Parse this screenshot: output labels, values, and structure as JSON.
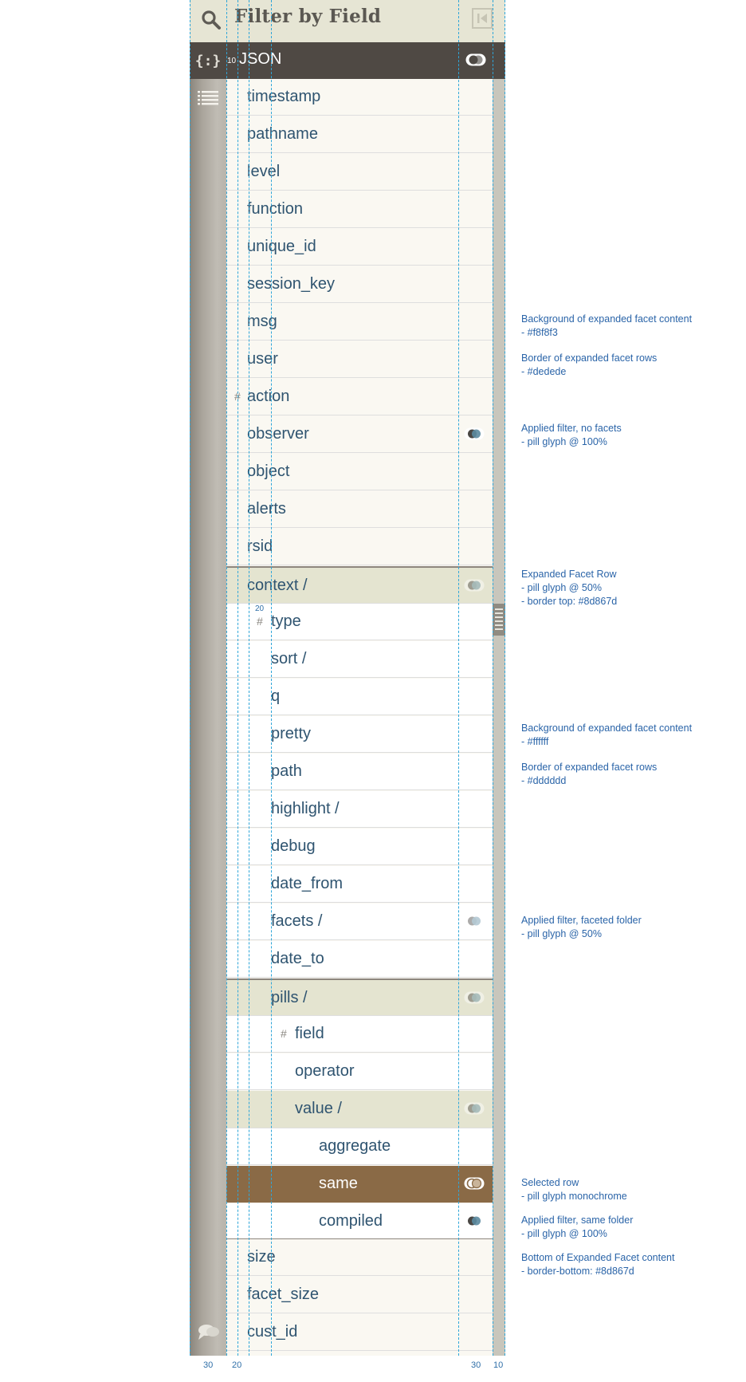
{
  "header": {
    "title": "Filter by Field"
  },
  "json_bar": {
    "icon": "{:}",
    "label": "JSON",
    "indent_mark": "10"
  },
  "rows": [
    {
      "label": "timestamp"
    },
    {
      "label": "pathname"
    },
    {
      "label": "level"
    },
    {
      "label": "function"
    },
    {
      "label": "unique_id"
    },
    {
      "label": "session_key"
    },
    {
      "label": "msg"
    },
    {
      "label": "user"
    },
    {
      "label": "action",
      "hash": "#"
    },
    {
      "label": "observer",
      "pill": "full"
    },
    {
      "label": "object"
    },
    {
      "label": "alerts"
    },
    {
      "label": "rsid"
    },
    {
      "label": "context /",
      "pill": "half"
    },
    {
      "label": "type",
      "hash": "#",
      "indent_mark": "20"
    },
    {
      "label": "sort /"
    },
    {
      "label": "q"
    },
    {
      "label": "pretty"
    },
    {
      "label": "path"
    },
    {
      "label": "highlight /"
    },
    {
      "label": "debug"
    },
    {
      "label": "date_from"
    },
    {
      "label": "facets /",
      "pill": "half"
    },
    {
      "label": "date_to"
    },
    {
      "label": "pills /",
      "pill": "half"
    },
    {
      "label": "field",
      "hash": "#"
    },
    {
      "label": "operator"
    },
    {
      "label": "value /",
      "pill": "half"
    },
    {
      "label": "aggregate"
    },
    {
      "label": "same",
      "pill": "mono"
    },
    {
      "label": "compiled",
      "pill": "full"
    },
    {
      "label": "size"
    },
    {
      "label": "facet_size"
    },
    {
      "label": "cust_id"
    }
  ],
  "measurements": {
    "rail": "30",
    "indent": "20",
    "pill_column": "30",
    "scrollbar": "10"
  },
  "annotations": [
    {
      "title": "Background of expanded facet content",
      "detail": "- #f8f8f3"
    },
    {
      "title": "Border of expanded facet rows",
      "detail": "- #dedede"
    },
    {
      "title": "Applied filter,  no facets",
      "detail": "- pill glyph @ 100%"
    },
    {
      "title": "Expanded Facet Row",
      "detail": "- pill glyph @ 50%",
      "detail2": "- border top: #8d867d"
    },
    {
      "title": "Background of expanded facet content",
      "detail": "- #ffffff"
    },
    {
      "title": "Border of expanded facet rows",
      "detail": "- #dddddd"
    },
    {
      "title": "Applied filter, faceted folder",
      "detail": "- pill glyph @ 50%"
    },
    {
      "title": "Selected row",
      "detail": "- pill glyph monochrome"
    },
    {
      "title": "Applied filter, same folder",
      "detail": "- pill glyph @ 100%"
    },
    {
      "title": "Bottom of Expanded Facet content",
      "detail": "- border-bottom: #8d867d"
    }
  ],
  "colors": {
    "header_bg": "#e6e5d4",
    "json_bar_bg": "#4f4944",
    "row_bg": "#f8f8f3",
    "row_border": "#dedede",
    "expanded_bg": "#ffffff",
    "expanded_border": "#dddddd",
    "folder_bg": "#e4e4d0",
    "expanded_border_top": "#8d867d",
    "selected_bg": "#8a6a46",
    "text": "#2f5470",
    "annotation_text": "#2a64a8",
    "guide": "#2fa6d9"
  },
  "icons": [
    "search-icon",
    "collapse-panel-icon",
    "json-braces-icon",
    "list-icon",
    "chat-icon",
    "pill-toggle-icon",
    "grip-icon"
  ]
}
